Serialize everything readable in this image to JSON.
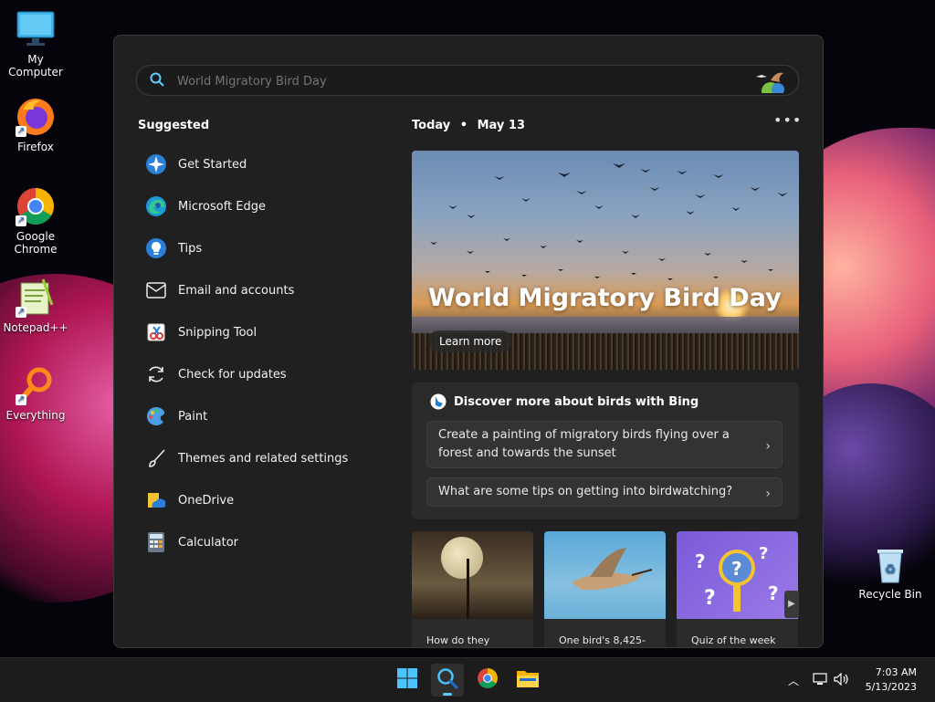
{
  "desktop": {
    "icons": [
      {
        "label": "My Computer",
        "icon": "monitor-icon"
      },
      {
        "label": "Firefox",
        "icon": "firefox-icon"
      },
      {
        "label": "Google Chrome",
        "icon": "chrome-icon"
      },
      {
        "label": "Notepad++",
        "icon": "notepadpp-icon"
      },
      {
        "label": "Everything",
        "icon": "everything-icon"
      },
      {
        "label": "Recycle Bin",
        "icon": "recycle-bin-icon"
      }
    ]
  },
  "search": {
    "value": "",
    "placeholder": "World Migratory Bird Day"
  },
  "suggested": {
    "title": "Suggested",
    "items": [
      {
        "label": "Get Started",
        "icon": "get-started-icon"
      },
      {
        "label": "Microsoft Edge",
        "icon": "edge-icon"
      },
      {
        "label": "Tips",
        "icon": "tips-icon"
      },
      {
        "label": "Email and accounts",
        "icon": "mail-icon"
      },
      {
        "label": "Snipping Tool",
        "icon": "snipping-tool-icon"
      },
      {
        "label": "Check for updates",
        "icon": "refresh-icon"
      },
      {
        "label": "Paint",
        "icon": "paint-icon"
      },
      {
        "label": "Themes and related settings",
        "icon": "brush-icon"
      },
      {
        "label": "OneDrive",
        "icon": "onedrive-icon"
      },
      {
        "label": "Calculator",
        "icon": "calculator-icon"
      }
    ]
  },
  "today": {
    "label": "Today",
    "separator": "•",
    "date": "May 13",
    "more": "•••"
  },
  "hero": {
    "title": "World Migratory Bird Day",
    "button": "Learn more"
  },
  "bing": {
    "title": "Discover more about birds with Bing",
    "prompts": [
      "Create a painting of migratory birds flying over a forest and towards the sunset",
      "What are some tips on getting into birdwatching?"
    ]
  },
  "tiles": [
    {
      "caption": "How do they"
    },
    {
      "caption": "One bird's 8,425-"
    },
    {
      "caption": "Quiz of the week"
    }
  ],
  "taskbar": {
    "apps": [
      "start-icon",
      "search-icon",
      "chrome-icon",
      "file-explorer-icon"
    ],
    "time": "7:03 AM",
    "date": "5/13/2023"
  },
  "colors": {
    "accent": "#60cdff",
    "panel": "#202020"
  }
}
